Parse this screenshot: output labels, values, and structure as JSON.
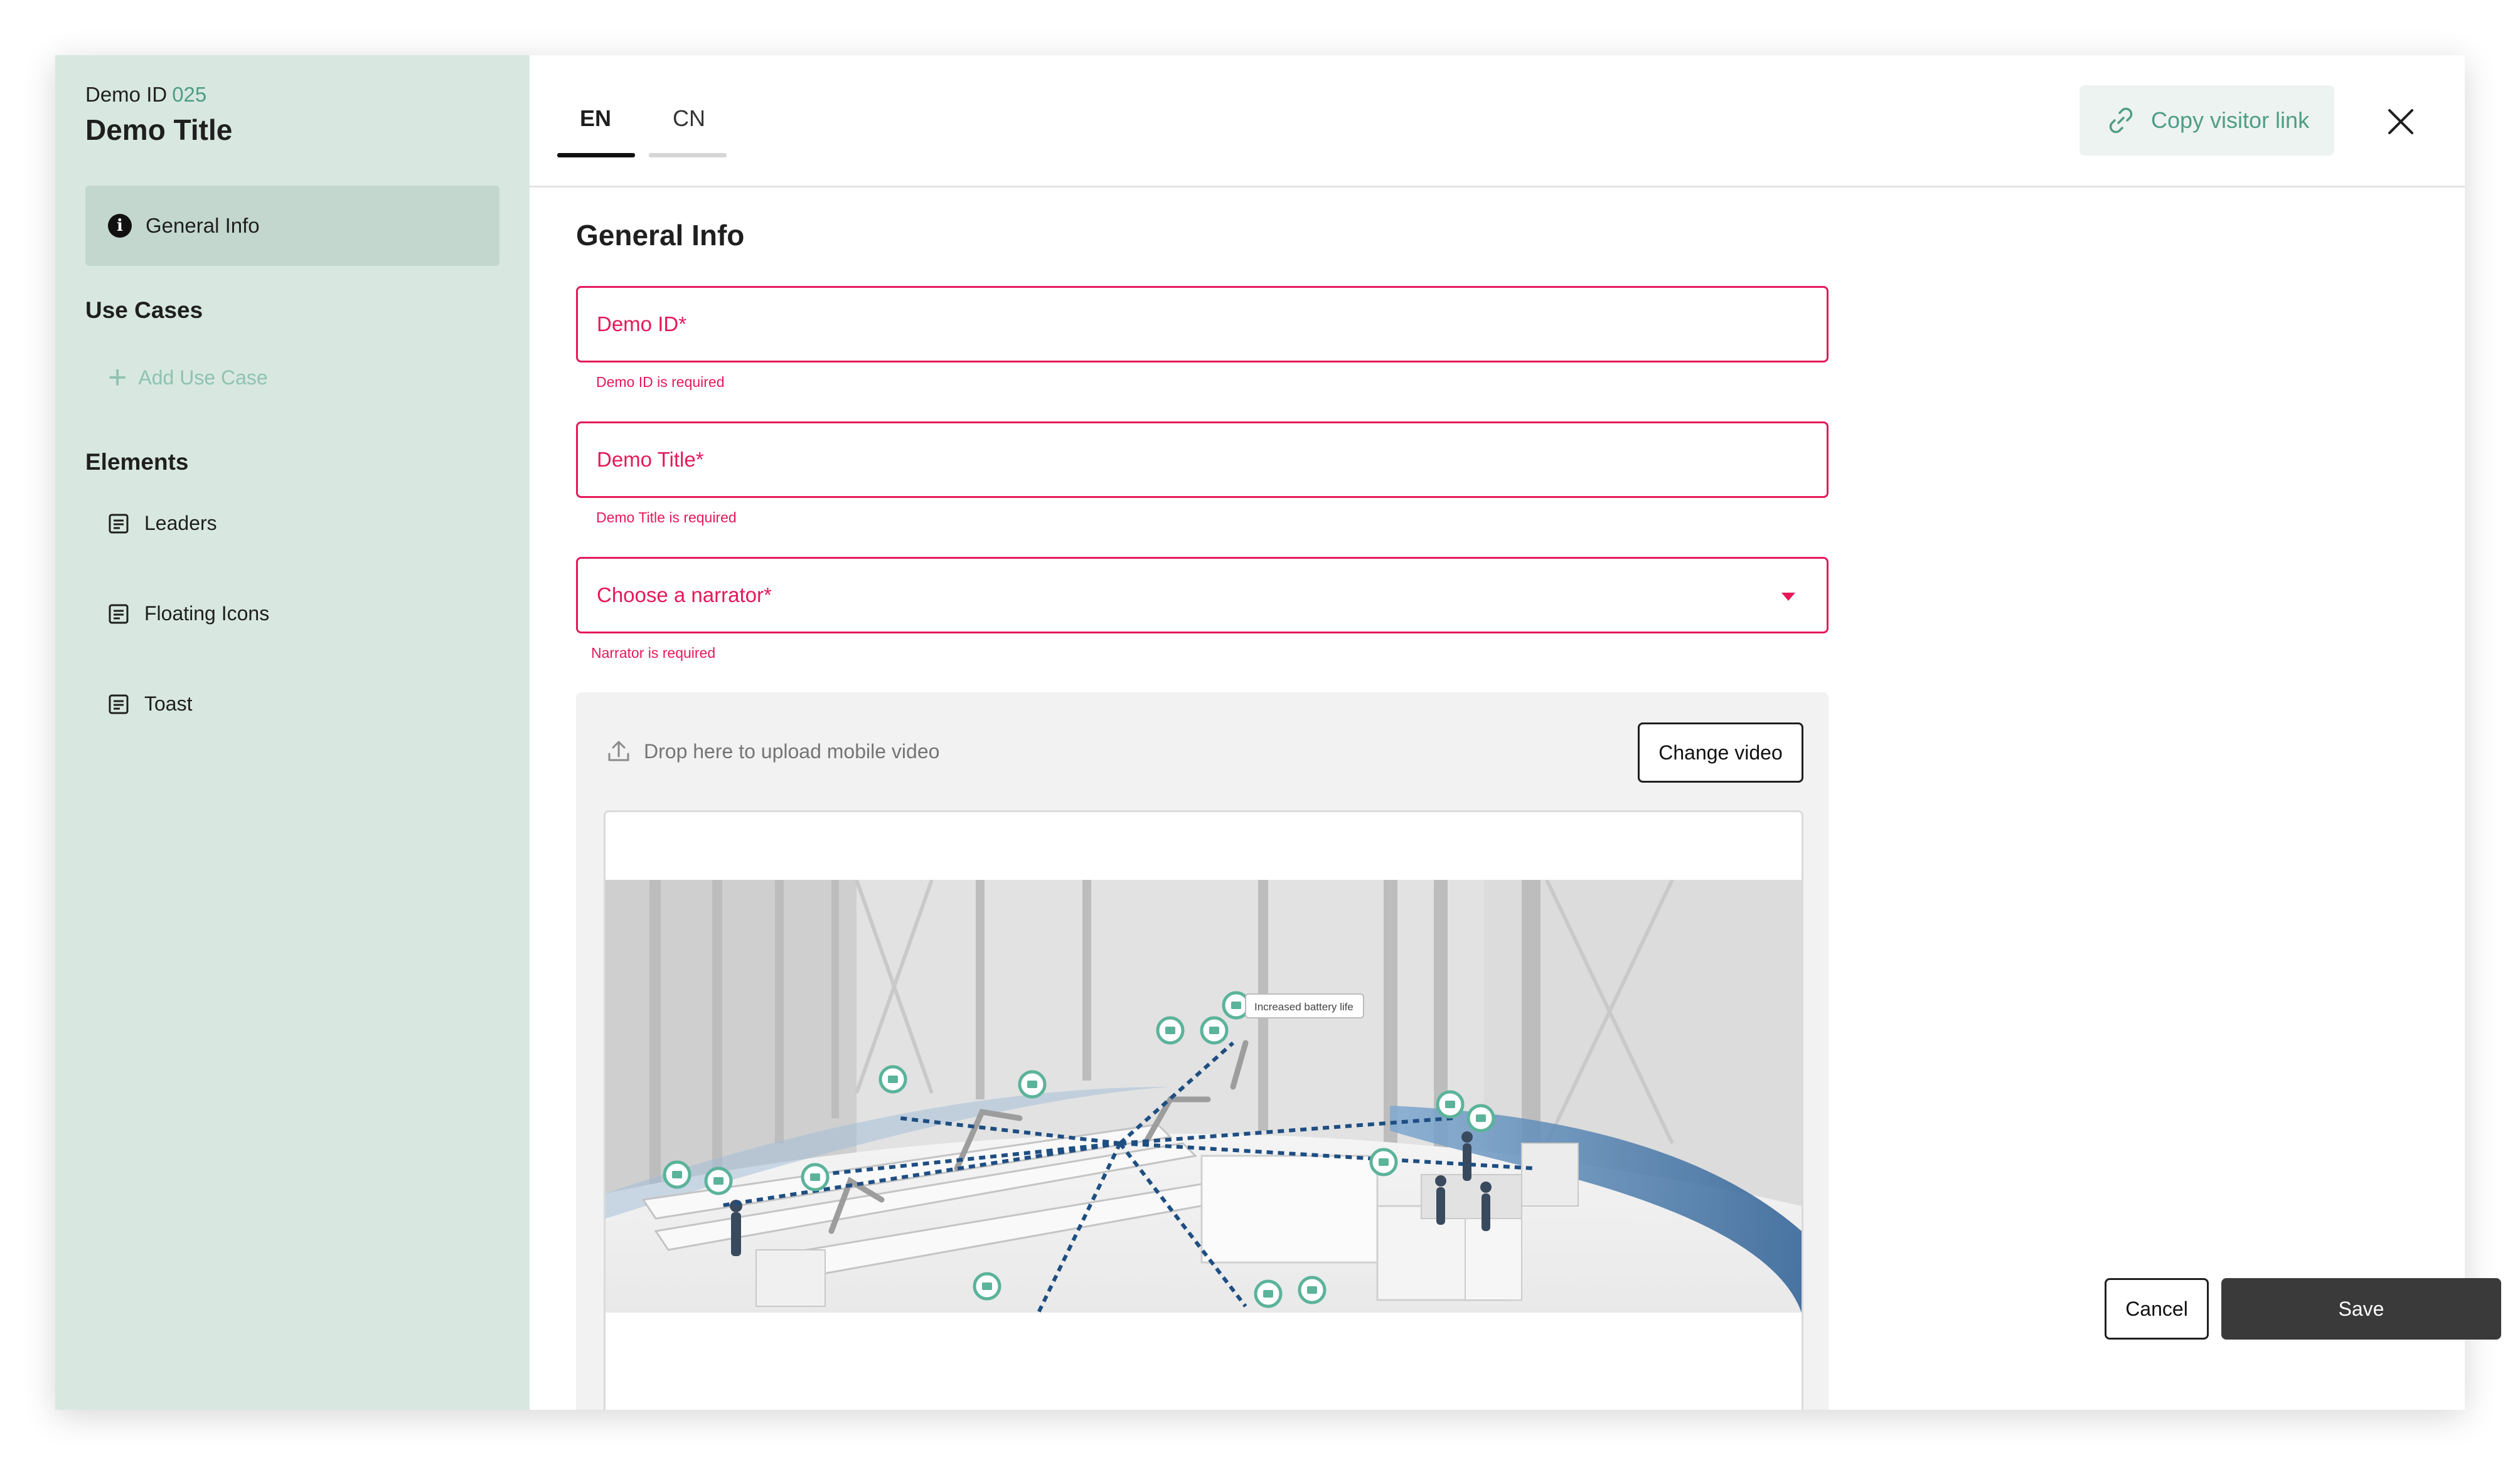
{
  "sidebar": {
    "demo_id_label": "Demo ID",
    "demo_id_value": "025",
    "demo_title": "Demo Title",
    "general_info": "General Info",
    "use_cases_heading": "Use Cases",
    "add_use_case": "Add Use Case",
    "elements_heading": "Elements",
    "elements": [
      {
        "label": "Leaders"
      },
      {
        "label": "Floating Icons"
      },
      {
        "label": "Toast"
      }
    ]
  },
  "header": {
    "tabs": [
      {
        "label": "EN",
        "active": true
      },
      {
        "label": "CN",
        "active": false
      }
    ],
    "copy_visitor_link": "Copy visitor link"
  },
  "form": {
    "title": "General Info",
    "demo_id": {
      "label": "Demo ID*",
      "error": "Demo ID is required"
    },
    "demo_title": {
      "label": "Demo Title*",
      "error": "Demo Title is required"
    },
    "narrator": {
      "label": "Choose a narrator*",
      "error": "Narrator is required"
    },
    "upload": {
      "hint": "Drop here to upload mobile video",
      "change_video": "Change video",
      "preview_tooltip": "Increased battery life"
    }
  },
  "footer": {
    "cancel": "Cancel",
    "save": "Save"
  },
  "colors": {
    "sidebar_bg": "#d8e8e1",
    "accent_green": "#4f9d86",
    "error_red": "#e5195a",
    "save_bg": "#3a3a3a"
  }
}
